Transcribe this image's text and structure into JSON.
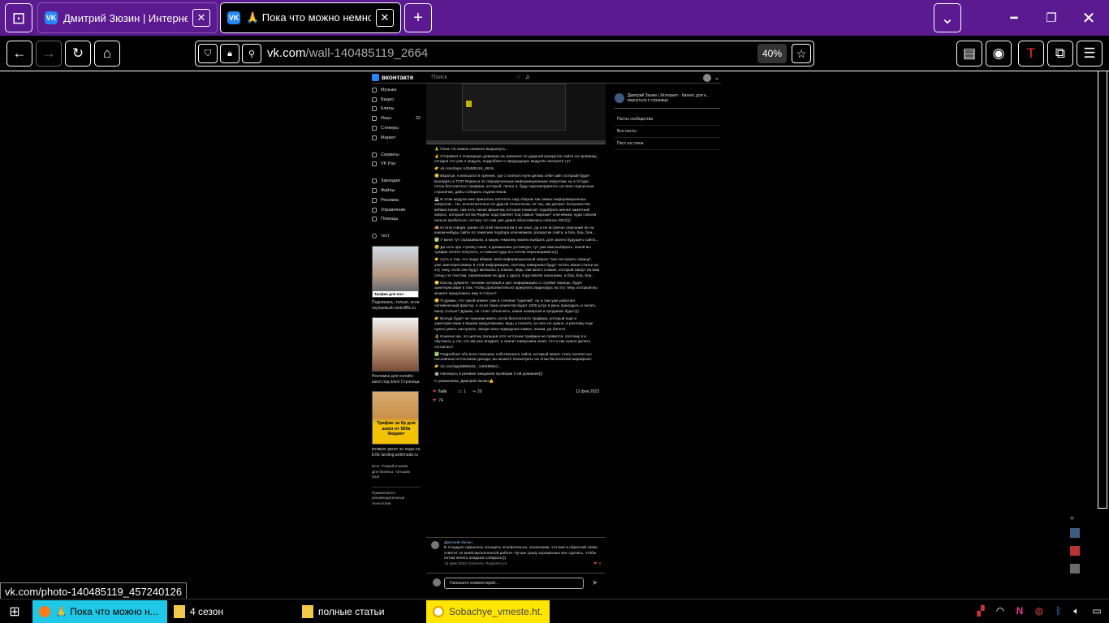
{
  "browser": {
    "tabs": [
      {
        "title": "Дмитрий Зюзин | Интернет -",
        "active": false
      },
      {
        "title": "🙏 Пока что можно немного",
        "active": true
      }
    ],
    "new_tab_label": "+",
    "url_host": "vk.com",
    "url_path": "/wall-140485119_2664",
    "zoom": "40%"
  },
  "vk": {
    "logo": "вконтакте",
    "search_placeholder": "Поиск",
    "menu_group1": [
      "Музыка",
      "Видео",
      "Клипы",
      "Игры",
      "Стикеры",
      "Маркет"
    ],
    "menu_group2": [
      "Сервисы",
      "VK Pay"
    ],
    "menu_group3": [
      "Закладки",
      "Файлы",
      "Реклама",
      "Управление",
      "Помощь"
    ],
    "menu_group4": [
      "тест"
    ],
    "games_badge": "22",
    "ads": [
      {
        "banner": "Трафик для онл",
        "caption": "Подпишись, только, если окупаемый vsetrafffic.ru"
      },
      {
        "banner": "",
        "caption": "Рекламка для онлайн-школ под ключ Страница"
      },
      {
        "banner": "Трафик за 0р для школ от 500к бюджет",
        "caption": "возврат денег за лиды на EXE landing.antlrmade.ru"
      }
    ],
    "footer_links": [
      "Блог",
      "Разработчикам",
      "Для бизнеса",
      "Авторам",
      "Ещё"
    ],
    "footer_note": "Применяются рекомендательные технологии",
    "post": {
      "lines": [
        "🙏 Пока что можно немного выдохнуть...",
        "☝️ Отправил я очередную домашку на тренинге по ударной раскрутке сайта на проверку, сегодня это уже 2 модуль, подробнее о предыдущих модулях смотрите тут:",
        "👉 vk.com/topic-140485119_4919...",
        "😊 Вкратце, я вписался в тренинг, где с полного нуля делаю себе сайт, который будет выходить в ТОП Яндекса по определенным информационным запросам, ну а оттуда поток бесплатного трафика, который, лично я, буду перенаправлять на свои подписные странички, дабы собирать подписчиков.",
        "💻 В этом модуле мне пришлось попотеть над сбором так самых информационных запросов... Но, исключительно по другой технологии, не так, как делают большинство вебмастеров, там есть некая фишечка, которая помогает подобрать менее заметный запрос, который потом Яндекс подставляет под самые \"жирные\" ключевики, куда совсем нельзя пробиться, потому что там уже давно обосновались гиганты SEO)))",
        "🙈 Кстати говоря, ранее об этой технологии я не знал, да и не встречал описание не на каком-нибудь сайте по тематике подбора ключевиков, раскрутки сайта, и бла, бла, бла...",
        "✅ У меня тут спрашивали, а какую тематику можно выбрать для своего будущего сайта...",
        "😉 Да хоть про стряпку свою, в домашнюю условную, тут уже вам выбирать, какой вы трафик хотите получить, а главное куда его потом перенаправить)))",
        "👉 Суть в том, что люди вбивая свой информационный запрос \"как построить сванцу\", уже заинтересованы в этой информации, поэтому наверника будут читать ваши статьи на эту тему, если они будут мелькать в поиске, ведь там много схожих, который пишут на вам спецы по текстам, перепихивая их друг у друга, подставляя синонимы, и бла, бла, бла...",
        "😳 Как вы думаете, человек который и щет информацию о стройке сванцы, будет заинтересован в том, чтобы дополнительно прикупить видеокурс на эту тему, который вы можете предложить ему в статье?",
        "😏 Я думаю, что такой клиент уже в степени \"горячий\", ну а там уже работает человеческий фактор. А если таких клиентов будет 1000 штук в день приходить и читать вашу статью? Думаю, не стоит объяснять, какая конверсия в продажах будет)))",
        "👉 Всегда будет не лишним иметь поток бесплатного трафика, который ещё и заинтересован в вашем предложении, ведь и платить за него не нужно, в рекламу еще нужно уметь настроить, вводя свои подводные камни, лихим, да болото.",
        "👌 Конечно же, по щелчку пальцев этот источник трафика не появится, поэтому я и обучаюсь у тех, кто им уже владеет, а значит наверника знает, что и как нужно делать, согласны?",
        "✅ Подробнее обо всех плюшках собственного сайта, который может стать полностью пассивным источником дохода, вы можете посмотреть на этом бесплатном марафоне:",
        "👉 vk.com/app5898182_-140485611...",
        "🤖 Нахожусь в режиме ожидания проверки 2-ой домашки)))",
        "С уважением, Дмитрий Зюзин👍"
      ],
      "like_label": "Лайк",
      "comments_count": "1",
      "shares_count": "20",
      "date": "12 фев 2023",
      "likes_total": "74"
    },
    "right_col": {
      "owner": "Дмитрий Зюзин | Интернет - бизнес для н... вернуться к странице",
      "links": [
        "Посты сообщества",
        "Все посты",
        "Пост на стене"
      ]
    },
    "comment": {
      "author": "Дмитрий Зюзин",
      "text": "В 3 модуле пришлось поседеть основательно, посмотрим, что мне в обратной связи ответят по моей выполненной работе. Лучше сразу хорошенько все сделать, чтобы потом ничего опадком собирать)))",
      "meta": "13 фев 2023  Ответить  Поделиться",
      "likes": "3"
    },
    "composer_placeholder": "Напишите комментарий..."
  },
  "status_tip": "vk.com/photo-140485119_457240126",
  "taskbar": {
    "items": [
      {
        "label": "🙏 Пока что можно н...",
        "kind": "firefox"
      },
      {
        "label": "4 сезон",
        "kind": "folder"
      },
      {
        "label": "полные статьи",
        "kind": "folder"
      },
      {
        "label": "Sobachye_vmeste.ht...",
        "kind": "player"
      }
    ]
  },
  "colors": {
    "tabbar": "#5b1a8f",
    "accent_vk": "#2787f5",
    "taskbar_cyan": "#1ec8e6",
    "player_yellow": "#ffe600"
  }
}
